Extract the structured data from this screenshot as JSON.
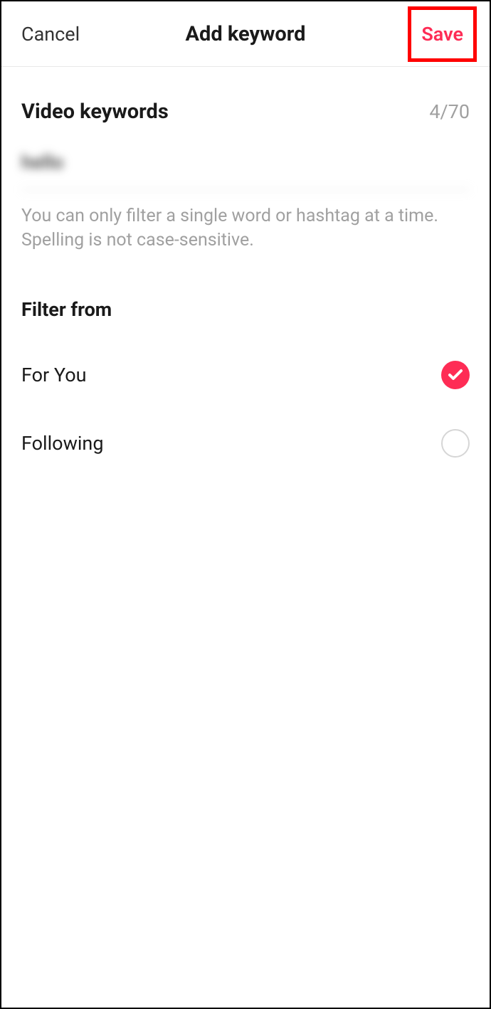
{
  "header": {
    "cancel_label": "Cancel",
    "title": "Add keyword",
    "save_label": "Save"
  },
  "keywords": {
    "section_title": "Video keywords",
    "counter": "4/70",
    "input_value": "hello",
    "helper_text": "You can only filter a single word or hashtag at a time. Spelling is not case-sensitive."
  },
  "filter": {
    "section_title": "Filter from",
    "options": [
      {
        "label": "For You",
        "selected": true
      },
      {
        "label": "Following",
        "selected": false
      }
    ]
  },
  "colors": {
    "accent": "#fe2c55",
    "highlight_box": "#ff0000"
  }
}
